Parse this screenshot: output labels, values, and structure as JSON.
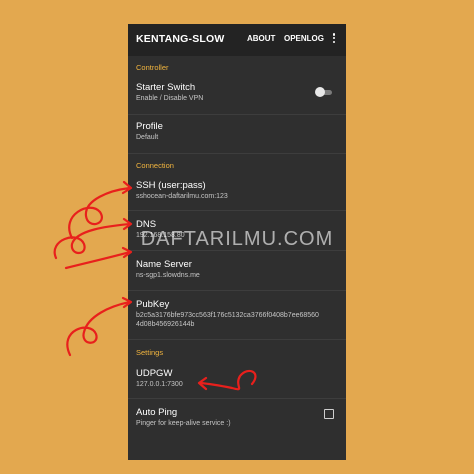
{
  "appbar": {
    "title": "KENTANG-SLOW",
    "about_label": "ABOUT",
    "openlog_label": "OPENLOG",
    "overflow_icon": "more-vert-icon"
  },
  "sections": {
    "controller": "Controller",
    "connection": "Connection",
    "settings": "Settings"
  },
  "prefs": {
    "starter_switch": {
      "title": "Starter Switch",
      "summary": "Enable / Disable VPN",
      "enabled": false
    },
    "profile": {
      "title": "Profile",
      "summary": "Default"
    },
    "ssh": {
      "title": "SSH (user:pass)",
      "summary": "sshocean-daftarilmu.com:123"
    },
    "dns": {
      "title": "DNS",
      "summary": "192.168.158.80"
    },
    "name_server": {
      "title": "Name Server",
      "summary": "ns-sgp1.slowdns.me"
    },
    "pubkey": {
      "title": "PubKey",
      "summary_line1": "b2c5a3176bfe973cc563f176c5132ca3766f0408b7ee68560",
      "summary_line2": "4d08b456926144b"
    },
    "udpgw": {
      "title": "UDPGW",
      "summary": "127.0.0.1:7300"
    },
    "auto_ping": {
      "title": "Auto Ping",
      "summary": "Pinger for keep-alive service :)",
      "checked": false
    }
  },
  "watermark": "DAFTARILMU.COM",
  "colors": {
    "background": "#e3a84f",
    "panel": "#2f2f2f",
    "appbar": "#232323",
    "section_accent": "#f2b53f",
    "annotation_red": "#e8201c"
  }
}
